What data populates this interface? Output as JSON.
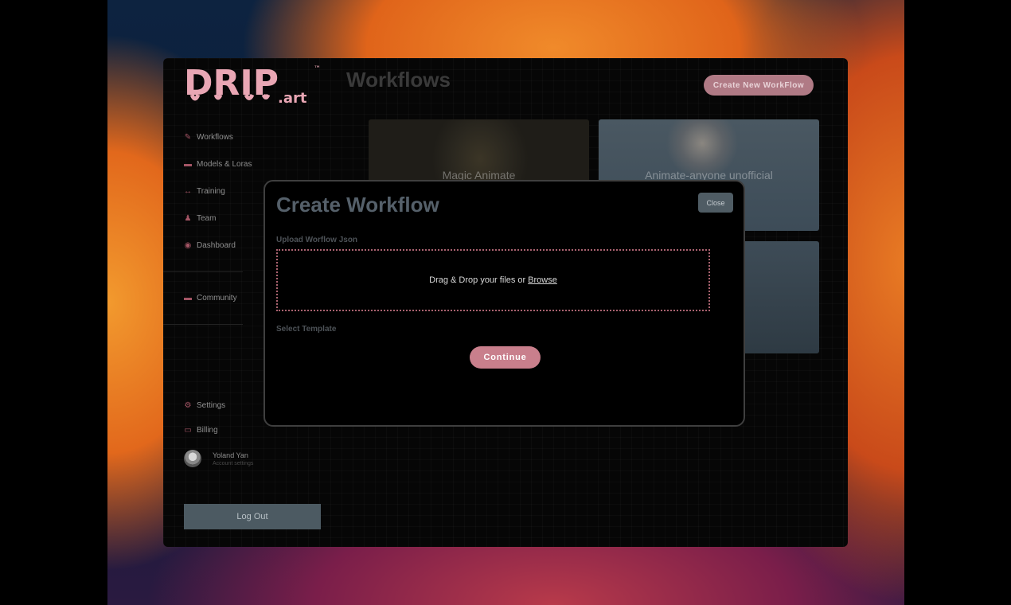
{
  "brand": {
    "logo_text": "DRIP",
    "logo_suffix": ".art",
    "trademark": "™"
  },
  "header": {
    "title": "Workflows",
    "create_button": "Create New WorkFlow"
  },
  "sidebar": {
    "items": [
      {
        "label": "Workflows",
        "icon": "wand-icon"
      },
      {
        "label": "Models & Loras",
        "icon": "model-icon"
      },
      {
        "label": "Training",
        "icon": "training-icon"
      },
      {
        "label": "Team",
        "icon": "team-icon"
      },
      {
        "label": "Dashboard",
        "icon": "dashboard-icon"
      },
      {
        "label": "Community",
        "icon": "community-icon"
      },
      {
        "label": "Settings",
        "icon": "gear-icon"
      },
      {
        "label": "Billing",
        "icon": "card-icon"
      }
    ],
    "user": {
      "name": "Yoland Yan",
      "subtitle": "Account settings"
    },
    "logout": "Log Out"
  },
  "cards": [
    {
      "title": "Magic Animate"
    },
    {
      "title": "Animate-anyone unofficial"
    },
    {
      "title": ""
    }
  ],
  "modal": {
    "title": "Create Workflow",
    "close": "Close",
    "upload_label": "Upload Worflow Json",
    "dropzone_text": "Drag & Drop your files or",
    "browse": "Browse",
    "template_label": "Select Template",
    "continue": "Continue"
  },
  "colors": {
    "accent": "#c97f8c",
    "accent_dark": "#a45565",
    "button_gray": "#4f5c64"
  }
}
